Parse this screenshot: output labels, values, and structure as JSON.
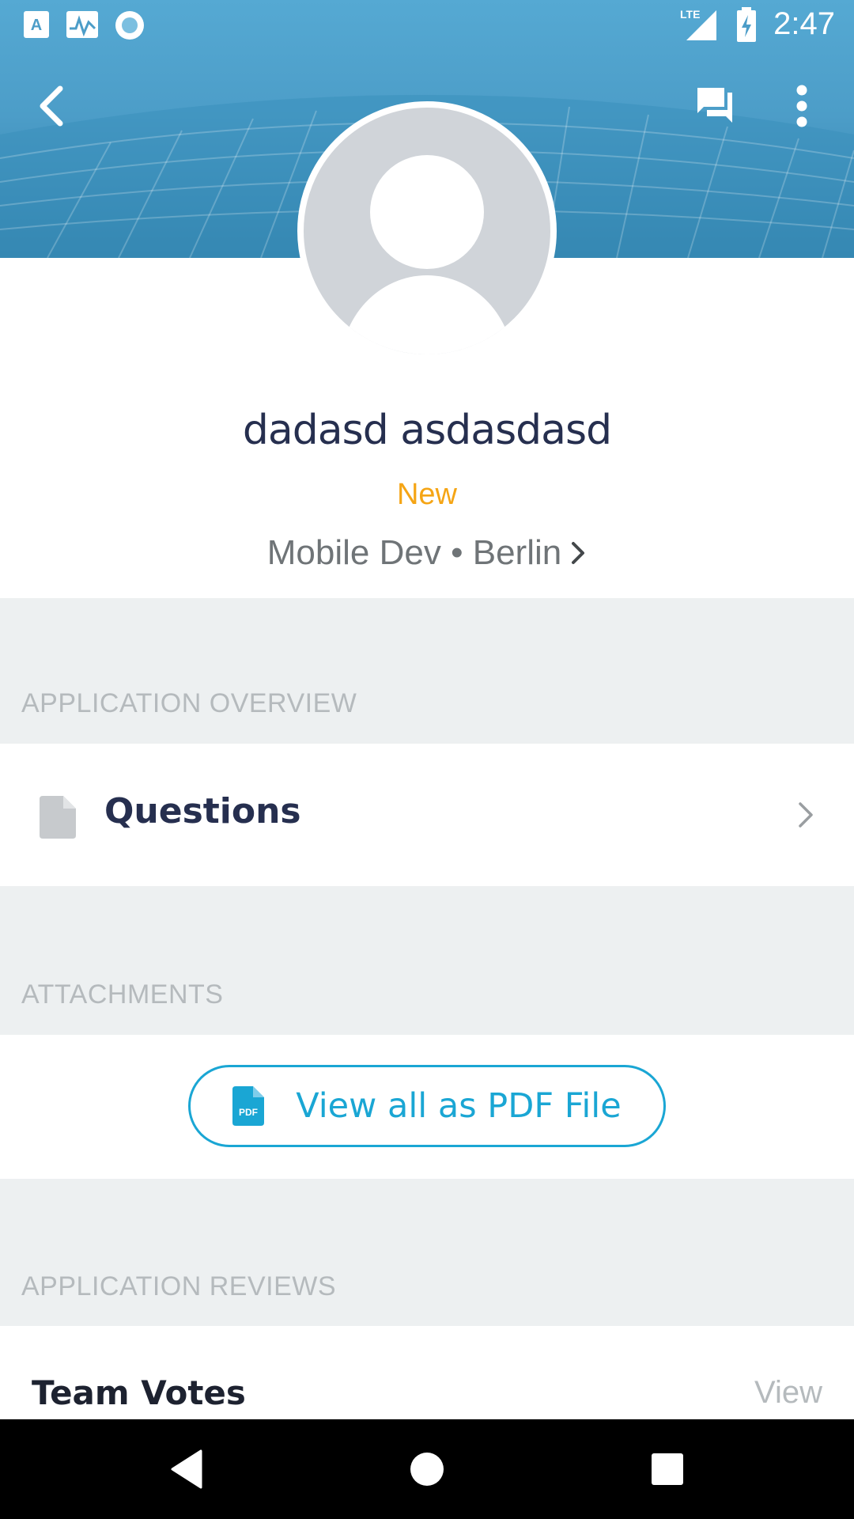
{
  "status_bar": {
    "time": "2:47",
    "network": "LTE",
    "icons": [
      "keyboard-icon",
      "activity-icon",
      "record-icon",
      "lte-signal-icon",
      "battery-charging-icon"
    ]
  },
  "toolbar": {
    "back_icon": "chevron-left-icon",
    "chat_icon": "chat-icon",
    "overflow_icon": "more-vert-icon"
  },
  "profile": {
    "name": "dadasd asdasdasd",
    "status": "New",
    "job_location": "Mobile Dev • Berlin"
  },
  "sections": {
    "overview": {
      "label": "APPLICATION OVERVIEW",
      "item_label": "Questions"
    },
    "attachments": {
      "label": "ATTACHMENTS",
      "button_label": "View all as PDF File",
      "pdf_badge": "PDF"
    },
    "reviews": {
      "label": "APPLICATION REVIEWS",
      "item_label": "Team Votes",
      "action_label": "View"
    }
  },
  "colors": {
    "banner": "#4c9dc8",
    "accent": "#1aa6d4",
    "status_new": "#f5a515",
    "title_text": "#262f4f"
  }
}
